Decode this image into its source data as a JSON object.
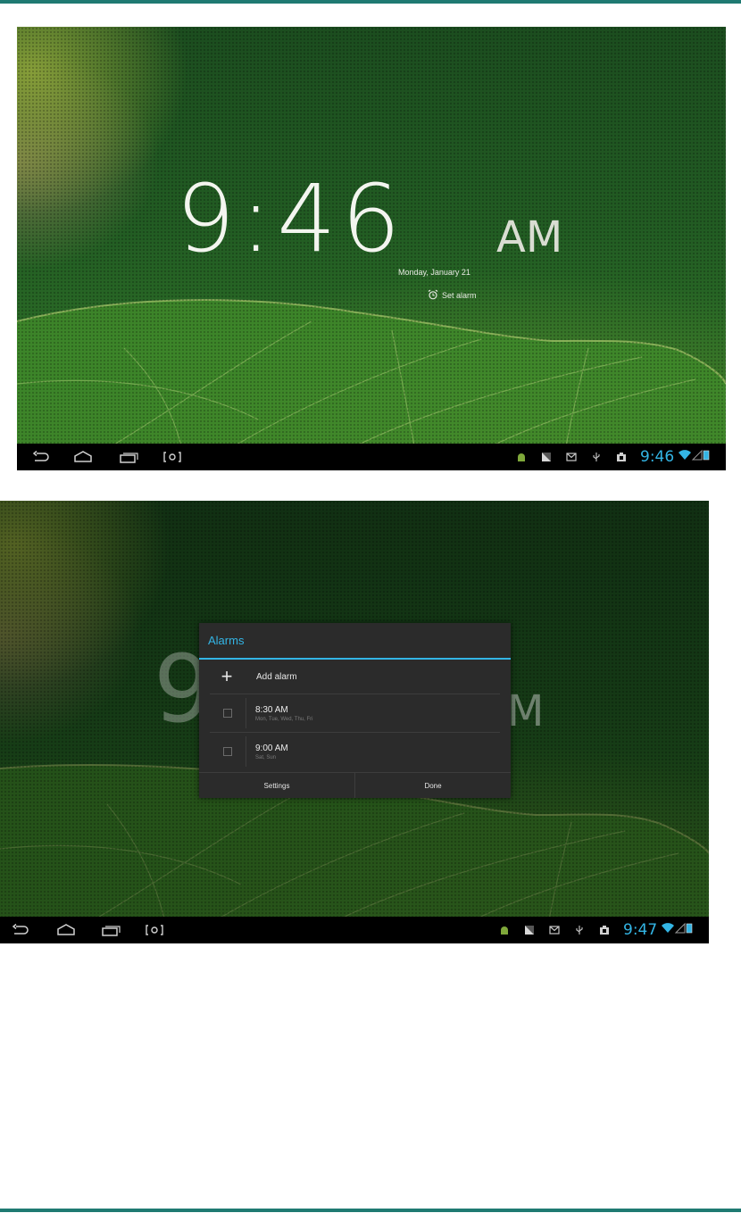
{
  "screen1": {
    "time": "9:46",
    "ampm": "AM",
    "date": "Monday, January 21",
    "set_alarm_label": "Set alarm",
    "status_clock": "9:46"
  },
  "screen2": {
    "ghost_time": "9",
    "ghost_ampm": "M",
    "status_clock": "9:47",
    "dialog": {
      "title": "Alarms",
      "add_alarm_label": "Add alarm",
      "alarms": [
        {
          "time": "8:30 AM",
          "days": "Mon, Tue, Wed, Thu, Fri"
        },
        {
          "time": "9:00 AM",
          "days": "Sat, Sun"
        }
      ],
      "settings_label": "Settings",
      "done_label": "Done"
    }
  },
  "colors": {
    "accent": "#33b5e5",
    "rule": "#1f7a72",
    "navbar": "#000000",
    "dialog_bg": "#2b2b2b"
  },
  "icons": {
    "nav": [
      "back-icon",
      "home-icon",
      "recent-apps-icon",
      "screenshot-icon"
    ],
    "tray": [
      "android-notification-icon",
      "notification-icon",
      "gmail-icon",
      "usb-icon",
      "media-icon",
      "wifi-icon",
      "signal-icon",
      "battery-icon"
    ]
  }
}
